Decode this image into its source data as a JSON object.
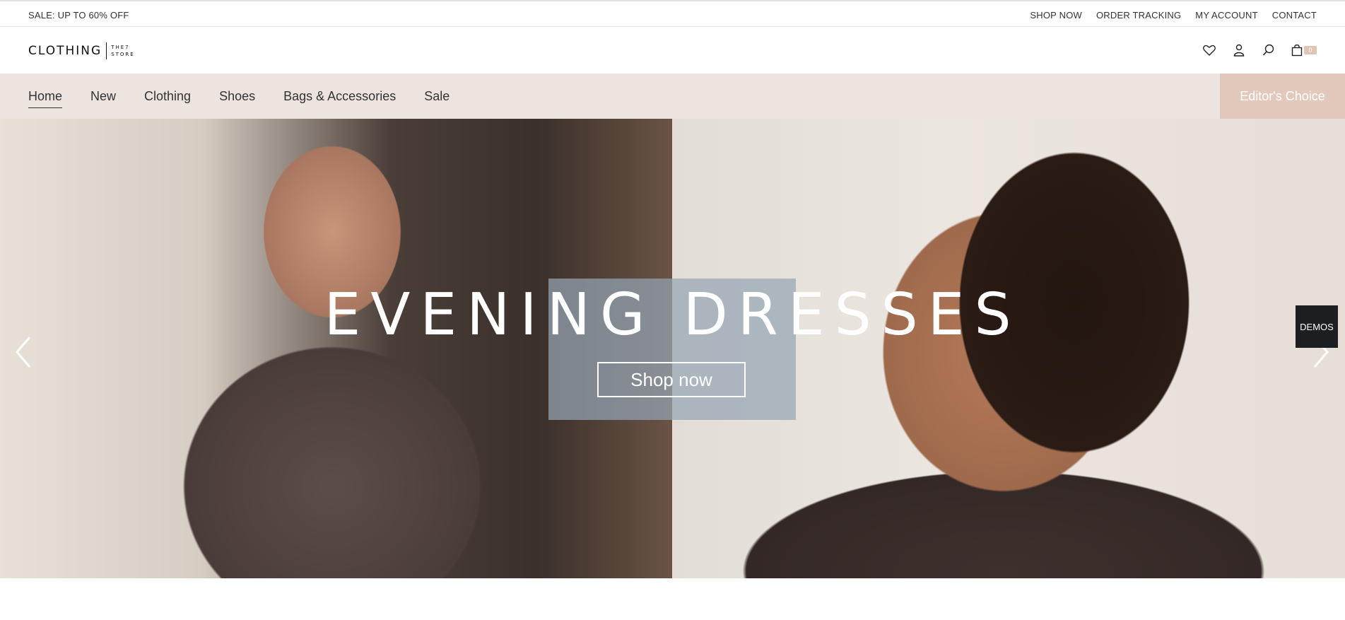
{
  "topbar": {
    "sale_text": "SALE: UP TO 60% OFF",
    "links": [
      "SHOP NOW",
      "ORDER TRACKING",
      "MY ACCOUNT",
      "CONTACT"
    ]
  },
  "header": {
    "logo_main": "CLOTHING",
    "logo_sub_line1": "THE7",
    "logo_sub_line2": "STORE",
    "icons": [
      "heart-icon",
      "user-icon",
      "search-icon",
      "bag-icon"
    ],
    "cart_count": "0",
    "cart_badge_color": "#e0c4b4"
  },
  "nav": {
    "items": [
      "Home",
      "New",
      "Clothing",
      "Shoes",
      "Bags & Accessories",
      "Sale"
    ],
    "active_item": "Home",
    "editors_choice": "Editor's Choice",
    "background_color": "#ede4df",
    "accent_color": "#e2c9bb"
  },
  "hero": {
    "title": "EVENING DRESSES",
    "button_label": "Shop now",
    "prev_icon": "chevron-left-icon",
    "next_icon": "chevron-right-icon",
    "demos_label": "DEMOS"
  }
}
